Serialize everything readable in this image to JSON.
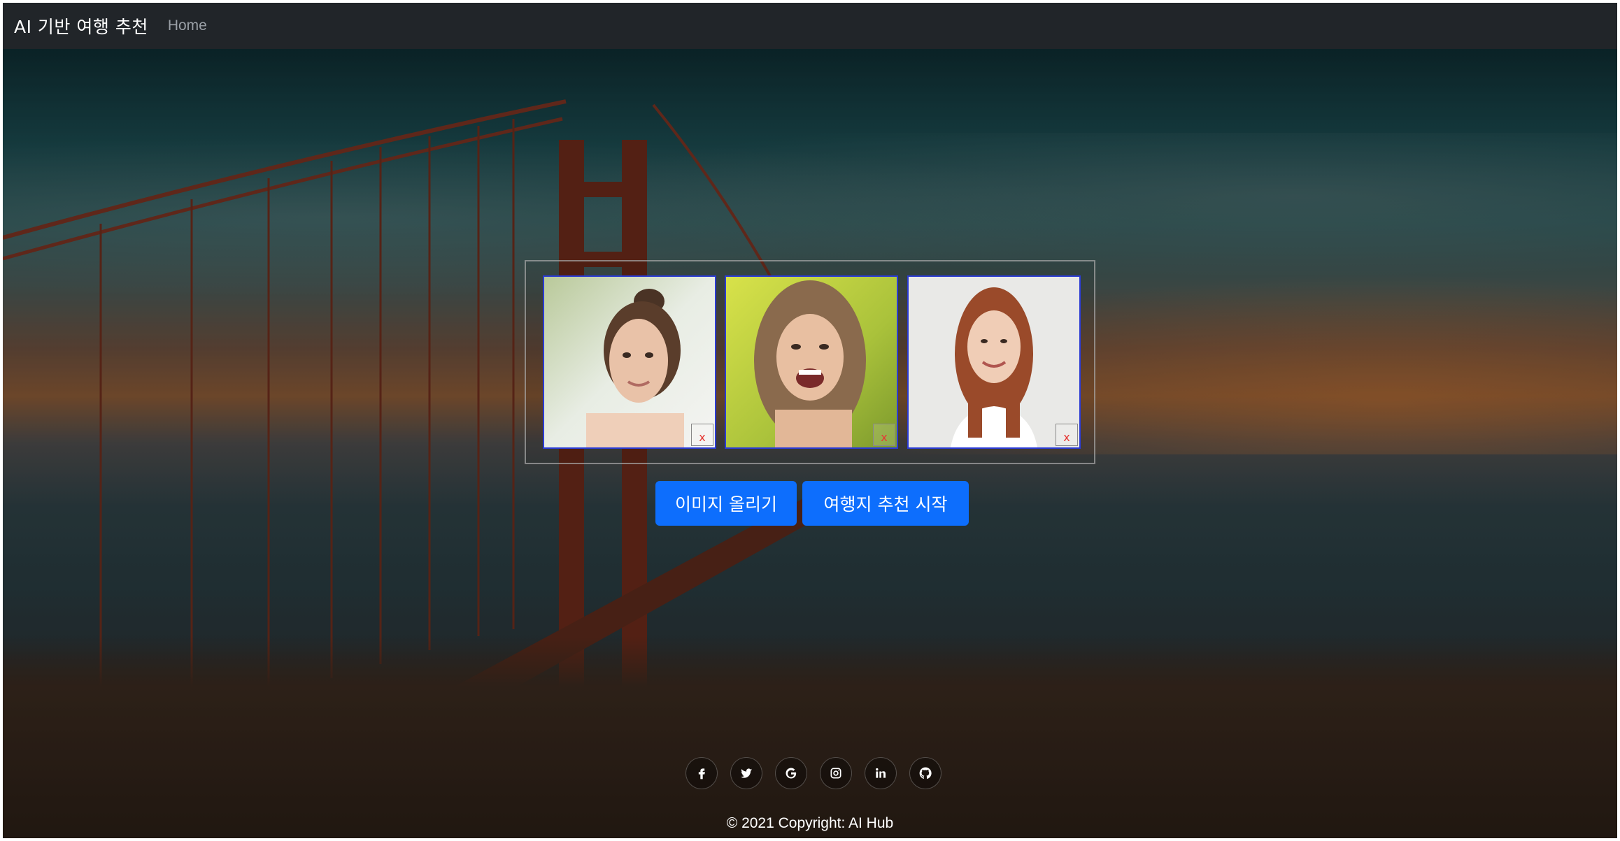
{
  "navbar": {
    "brand": "AI 기반 여행 추천",
    "links": [
      {
        "label": "Home"
      }
    ]
  },
  "gallery": {
    "images": [
      {
        "remove_label": "x"
      },
      {
        "remove_label": "x"
      },
      {
        "remove_label": "x"
      }
    ]
  },
  "actions": {
    "upload_label": "이미지 올리기",
    "start_label": "여행지 추천 시작"
  },
  "footer": {
    "social": [
      {
        "icon": "facebook-icon",
        "glyph": "f"
      },
      {
        "icon": "twitter-icon",
        "glyph": "t"
      },
      {
        "icon": "google-icon",
        "glyph": "G"
      },
      {
        "icon": "instagram-icon",
        "glyph": "ig"
      },
      {
        "icon": "linkedin-icon",
        "glyph": "in"
      },
      {
        "icon": "github-icon",
        "glyph": "gh"
      }
    ],
    "copyright": "© 2021 Copyright: AI Hub"
  },
  "colors": {
    "navbar_bg": "#212529",
    "primary": "#0d6efd",
    "thumb_border": "#2b3bd4",
    "remove": "#e53935"
  }
}
